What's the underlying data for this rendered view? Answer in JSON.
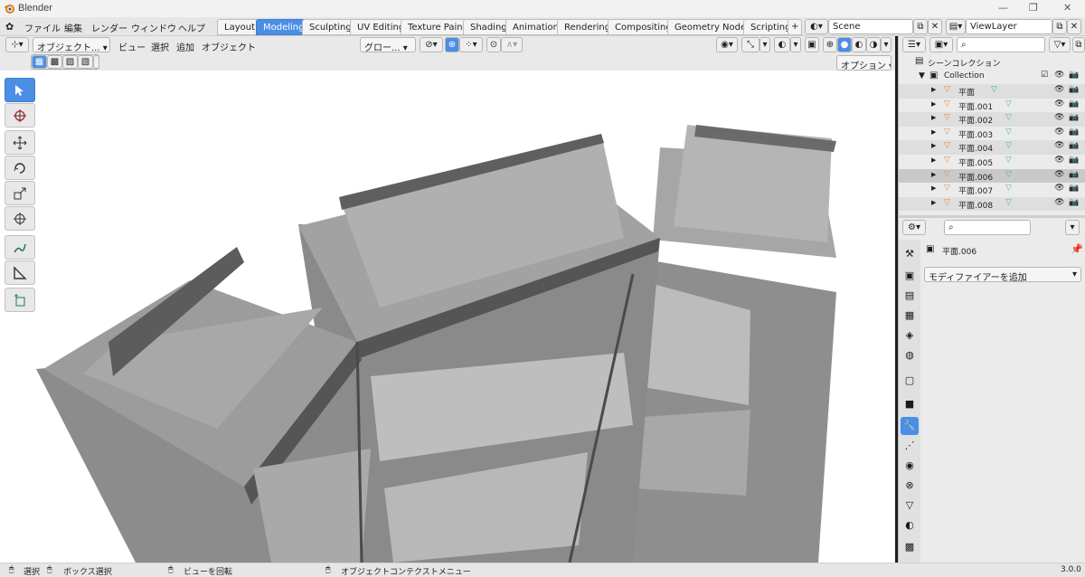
{
  "window": {
    "title": "Blender"
  },
  "menubar": {
    "items": [
      "ファイル",
      "編集",
      "レンダー",
      "ウィンドウ",
      "ヘルプ"
    ]
  },
  "workspaces": {
    "tabs": [
      "Layout",
      "Modeling",
      "Sculpting",
      "UV Editing",
      "Texture Paint",
      "Shading",
      "Animation",
      "Rendering",
      "Compositing",
      "Geometry Nodes",
      "Scripting"
    ],
    "active": "Modeling",
    "add": "+"
  },
  "scene": {
    "name": "Scene"
  },
  "view_layer": {
    "name": "ViewLayer"
  },
  "viewport": {
    "mode": "オブジェクト...",
    "menus": [
      "ビュー",
      "選択",
      "追加",
      "オブジェクト"
    ],
    "orientation": "グロー...",
    "options": "オプション"
  },
  "outliner": {
    "scene_collection": "シーンコレクション",
    "collection": "Collection",
    "objects": [
      "平面",
      "平面.001",
      "平面.002",
      "平面.003",
      "平面.004",
      "平面.005",
      "平面.006",
      "平面.007",
      "平面.008"
    ],
    "selected": "平面.006"
  },
  "properties": {
    "object_name": "平面.006",
    "add_modifier": "モディファイアーを追加"
  },
  "statusbar": {
    "select": "選択",
    "box_select": "ボックス選択",
    "rotate_view": "ビューを回転",
    "context_menu": "オブジェクトコンテクストメニュー",
    "version": "3.0.0"
  },
  "colors": {
    "accent": "#4b8ee6",
    "mesh_icon": "#e58a3c",
    "modifier_icon": "#4fb89a"
  }
}
